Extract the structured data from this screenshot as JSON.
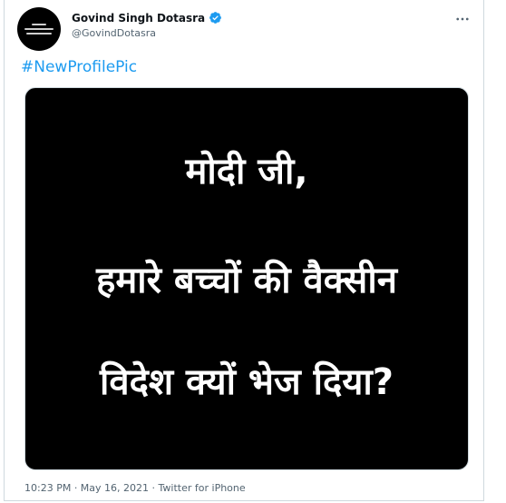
{
  "tweet": {
    "author": {
      "display_name": "Govind Singh Dotasra",
      "handle": "@GovindDotasra",
      "verified": true,
      "avatar_icon": "profile-picture"
    },
    "text": "#NewProfilePic",
    "media": {
      "lines": [
        "मोदी जी,",
        "हमारे बच्चों की वैक्सीन",
        "विदेश क्यों भेज दिया?"
      ],
      "background": "#000000",
      "text_color": "#ffffff"
    },
    "timestamp": "10:23 PM · May 16, 2021 · Twitter for iPhone"
  },
  "colors": {
    "link": "#1d9bf0",
    "verified": "#1d9bf0",
    "secondary_text": "#536471",
    "border": "#cfd9de"
  }
}
